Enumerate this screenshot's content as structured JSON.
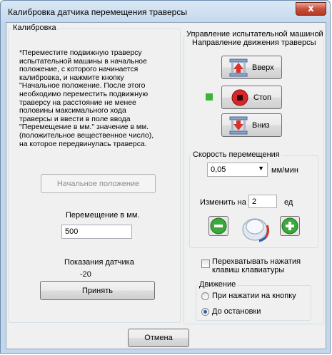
{
  "window": {
    "title": "Калибровка датчика перемещения траверсы",
    "close_label": "x"
  },
  "calibration": {
    "group_label": "Калибровка",
    "instructions": "*Переместите подвижную траверсу\nиспытательной машины в начальное\nположение, с которого начинается\nкалибровка, и нажмите кнопку\n\"Начальное положение. После этого\nнеобходимо переместить подвижную\nтраверсу на расстояние не менее\nполовины максимального хода\nтраверсы и ввести в поле ввода\n\"Перемещение в мм.\" значение в мм.\n(положительное вещественное число),\nна которое передвинулась траверса.",
    "start_position_label": "Начальное положение",
    "displacement_label": "Перемещение в мм.",
    "displacement_value": "500",
    "sensor_label": "Показания датчика",
    "sensor_value": "-20",
    "accept_label": "Принять"
  },
  "control": {
    "group_label": "Управление испытательной машиной",
    "direction_label": "Направление движения траверсы",
    "up_label": "Вверх",
    "stop_label": "Стоп",
    "down_label": "Вниз",
    "indicator_color": "#3cb43c",
    "speed": {
      "group_label": "Скорость перемещения",
      "value": "0,05",
      "unit": "мм/мин",
      "change_label": "Изменить на",
      "change_value": "2",
      "change_unit": "ед"
    },
    "intercept_keys_label": "Перехватывать нажатия\nклавиш клавиатуры",
    "intercept_keys_checked": false,
    "movement": {
      "group_label": "Движение",
      "options": [
        "При нажатии на кнопку",
        "До остановки"
      ],
      "selected": "До остановки"
    }
  },
  "cancel_label": "Отмена"
}
